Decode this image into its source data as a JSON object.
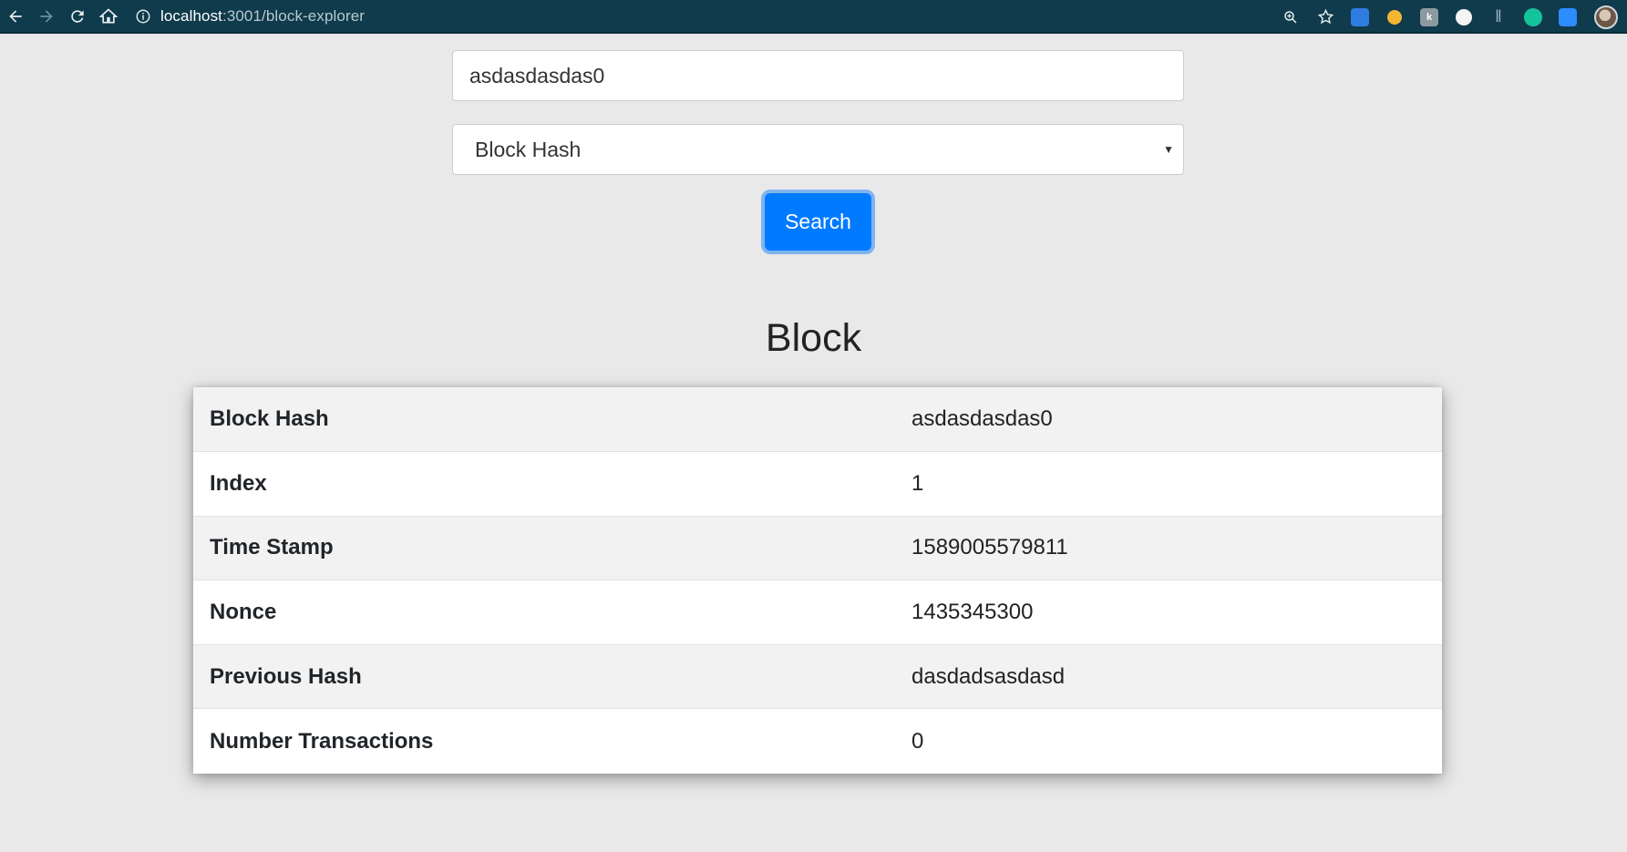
{
  "browser": {
    "url_host": "localhost",
    "url_path": ":3001/block-explorer"
  },
  "form": {
    "search_value": "asdasdasdas0",
    "select_value": "Block Hash",
    "search_button": "Search"
  },
  "block": {
    "title": "Block",
    "rows": [
      {
        "label": "Block Hash",
        "value": "asdasdasdas0"
      },
      {
        "label": "Index",
        "value": "1"
      },
      {
        "label": "Time Stamp",
        "value": "1589005579811"
      },
      {
        "label": "Nonce",
        "value": "1435345300"
      },
      {
        "label": "Previous Hash",
        "value": "dasdadsasdasd"
      },
      {
        "label": "Number Transactions",
        "value": "0"
      }
    ]
  },
  "colors": {
    "chrome_bg": "#0f3b4c",
    "primary": "#007bff",
    "page_bg": "#e9e9e9"
  }
}
